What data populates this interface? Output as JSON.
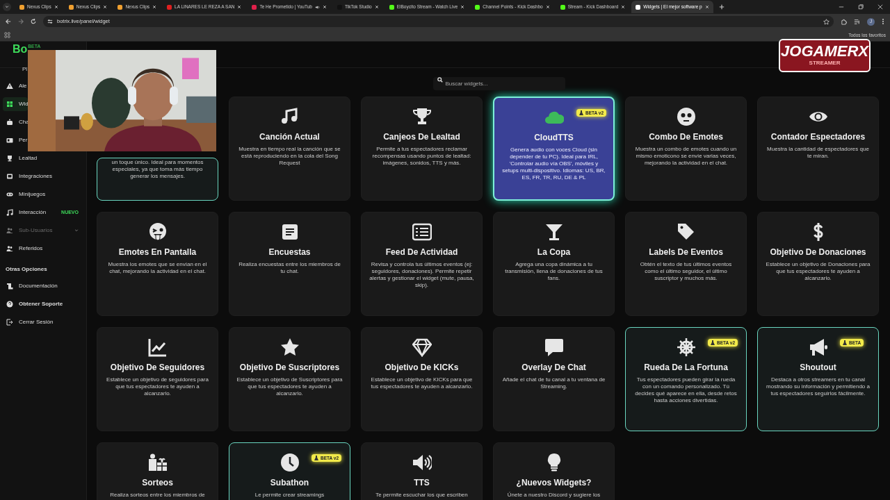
{
  "browser": {
    "tabs": [
      {
        "title": "Nexus Clips",
        "selected": false,
        "color": "#f0a030",
        "audio": false
      },
      {
        "title": "Nexus Clips",
        "selected": false,
        "color": "#f0a030",
        "audio": false
      },
      {
        "title": "Nexus Clips",
        "selected": false,
        "color": "#f0a030",
        "audio": false
      },
      {
        "title": "LA LINARES LE REZA A SAN",
        "selected": false,
        "color": "#e02020",
        "audio": false
      },
      {
        "title": "Te He Prometido | YouTub",
        "selected": false,
        "color": "#e0204a",
        "audio": true
      },
      {
        "title": "TikTok Studio",
        "selected": false,
        "color": "#111111",
        "audio": false
      },
      {
        "title": "ElBoycito Stream - Watch Live",
        "selected": false,
        "color": "#53fc18",
        "audio": false
      },
      {
        "title": "Channel Points - Kick Dashbo",
        "selected": false,
        "color": "#53fc18",
        "audio": false
      },
      {
        "title": "Stream - Kick Dashboard",
        "selected": false,
        "color": "#53fc18",
        "audio": false
      },
      {
        "title": "Widgets | El mejor software p",
        "selected": true,
        "color": "#ffffff",
        "audio": false
      }
    ],
    "url": "botrix.live/panel/widget",
    "profile_initial": "J",
    "bookmarks_label": "Todos los favoritos"
  },
  "overlay": {
    "logo_text": "JOGAMERX",
    "logo_subtitle": "STREAMER"
  },
  "sidebar": {
    "brand": "Bo",
    "brand_badge": "BETA",
    "plan": "Pl",
    "items": [
      {
        "label": "Ale",
        "selected": false,
        "disabled": false,
        "expandable": false
      },
      {
        "label": "Wid",
        "selected": true,
        "disabled": false,
        "expandable": false
      },
      {
        "label": "Cha",
        "selected": false,
        "disabled": false,
        "expandable": false
      },
      {
        "label": "Per",
        "selected": false,
        "disabled": false,
        "expandable": false
      },
      {
        "label": "Lealtad",
        "selected": false,
        "disabled": false,
        "expandable": false
      },
      {
        "label": "Integraciones",
        "selected": false,
        "disabled": false,
        "expandable": false
      },
      {
        "label": "Minijuegos",
        "selected": false,
        "disabled": false,
        "expandable": false
      },
      {
        "label": "Interacción",
        "selected": false,
        "disabled": false,
        "expandable": false,
        "badge": "NUEVO"
      },
      {
        "label": "Sub-Usuarios",
        "selected": false,
        "disabled": true,
        "expandable": true
      },
      {
        "label": "Referidos",
        "selected": false,
        "disabled": false,
        "expandable": false
      }
    ],
    "section_title": "Otras Opciones",
    "other_items": [
      {
        "label": "Documentación",
        "bold": false
      },
      {
        "label": "Obtener Soporte",
        "bold": true
      },
      {
        "label": "Cerrar Sesión",
        "bold": false
      }
    ]
  },
  "search": {
    "placeholder": "Buscar widgets..."
  },
  "widgets": [
    {
      "description": "un toque único. Ideal para momentos especiales, ya que toma más tiempo generar los mensajes.",
      "active": true,
      "hovered": false
    },
    {
      "title": "Canción Actual",
      "description": "Muestra en tiempo real la canción que se está reproduciendo en la cola del Song Request",
      "active": false,
      "hovered": false
    },
    {
      "title": "Canjeos De Lealtad",
      "description": "Permite a tus espectadores reclamar recompensas usando puntos de lealtad: imágenes, sonidos, TTS y más.",
      "active": false,
      "hovered": false
    },
    {
      "title": "CloudTTS",
      "badge": "BETA v2",
      "description": "Genera audio con voces Cloud (sin depender de tu PC). Ideal para IRL, 'Controlar audio vía OBS', móviles y setups multi-dispositivo. Idiomas: US, BR, ES, FR, TR, RU, DE & PL",
      "active": false,
      "hovered": true
    },
    {
      "title": "Combo De Emotes",
      "description": "Muestra un combo de emotes cuando un mismo emoticono se envíe varias veces, mejorando la actividad en el chat.",
      "active": false,
      "hovered": false
    },
    {
      "title": "Contador Espectadores",
      "description": "Muestra la cantidad de espectadores que te miran.",
      "active": false,
      "hovered": false
    },
    {
      "title": "Emotes En Pantalla",
      "description": "Muestra los emotes que se envían en el chat, mejorando la actividad en el chat.",
      "active": false,
      "hovered": false
    },
    {
      "title": "Encuestas",
      "description": "Realiza encuestas entre los miembros de tu chat.",
      "active": false,
      "hovered": false
    },
    {
      "title": "Feed De Actividad",
      "description": "Revisa y controla tus últimos eventos (ej: seguidores, donaciones). Permite repetir alertas y gestionar el widget (mute, pausa, skip).",
      "active": false,
      "hovered": false
    },
    {
      "title": "La Copa",
      "description": "Agrega una copa dinámica a tu transmisión, llena de donaciones de tus fans.",
      "active": false,
      "hovered": false
    },
    {
      "title": "Labels De Eventos",
      "description": "Obtén el texto de tus últimos eventos como el último seguidor, el último suscriptor y muchos más.",
      "active": false,
      "hovered": false
    },
    {
      "title": "Objetivo De Donaciones",
      "description": "Establece un objetivo de Donaciones para que tus espectadores te ayuden a alcanzarlo.",
      "active": false,
      "hovered": false
    },
    {
      "title": "Objetivo De Seguidores",
      "description": "Establece un objetivo de seguidores para que tus espectadores te ayuden a alcanzarlo.",
      "active": false,
      "hovered": false
    },
    {
      "title": "Objetivo De Suscriptores",
      "description": "Establece un objetivo de Suscriptores para que tus espectadores te ayuden a alcanzarlo.",
      "active": false,
      "hovered": false
    },
    {
      "title": "Objetivo De KICKs",
      "description": "Establece un objetivo de KICKs para que tus espectadores te ayuden a alcanzarlo.",
      "active": false,
      "hovered": false
    },
    {
      "title": "Overlay De Chat",
      "description": "Añade el chat de tu canal a tu ventana de Streaming.",
      "active": false,
      "hovered": false
    },
    {
      "title": "Rueda De La Fortuna",
      "badge": "BETA v2",
      "description": "Tus espectadores pueden girar la rueda con un comando personalizado. Tú decides qué aparece en ella, desde retos hasta acciones divertidas.",
      "active": true,
      "hovered": false
    },
    {
      "title": "Shoutout",
      "badge": "BETA",
      "description": "Destaca a otros streamers en tu canal mostrando su información y permitiendo a tus espectadores seguirlos fácilmente.",
      "active": true,
      "hovered": false
    },
    {
      "title": "Sorteos",
      "description": "Realiza sorteos entre los miembros de",
      "active": false,
      "hovered": false
    },
    {
      "title": "Subathon",
      "badge": "BETA v2",
      "description": "Le permite crear streamings",
      "active": true,
      "hovered": false
    },
    {
      "title": "TTS",
      "description": "Te permite escuchar los que escriben",
      "active": false,
      "hovered": false
    },
    {
      "title": "¿Nuevos Widgets?",
      "description": "Únete a nuestro Discord y sugiere los",
      "active": false,
      "hovered": false
    }
  ]
}
